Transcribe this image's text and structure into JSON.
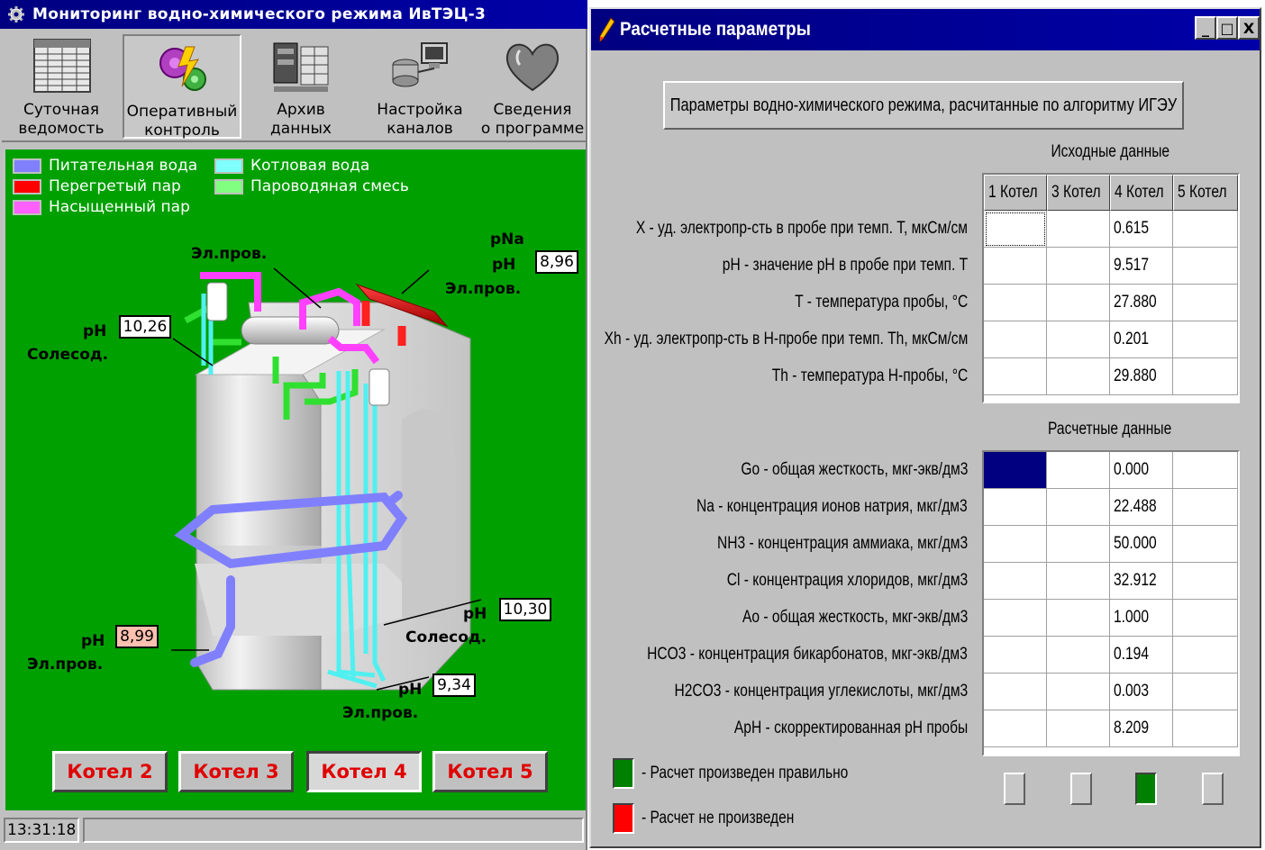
{
  "left_window": {
    "title": "Мониторинг водно-химического режима ИвТЭЦ-3",
    "toolbar": [
      {
        "label": "Суточная\nведомость",
        "icon": "table-icon"
      },
      {
        "label": "Оперативный\nконтроль",
        "icon": "gears-icon",
        "pressed": true
      },
      {
        "label": "Архив\nданных",
        "icon": "archive-icon"
      },
      {
        "label": "Настройка\nканалов",
        "icon": "network-icon"
      },
      {
        "label": "Сведения\nо программе",
        "icon": "heart-icon"
      }
    ],
    "legend": [
      {
        "label": "Питательная вода",
        "color": "#8080ff"
      },
      {
        "label": "Котловая вода",
        "color": "#80ffff"
      },
      {
        "label": "Перегретый пар",
        "color": "#ff0000"
      },
      {
        "label": "Пароводяная смесь",
        "color": "#80ff80"
      },
      {
        "label": "Насыщенный пар",
        "color": "#ff60ff"
      }
    ],
    "measurements": {
      "pna_label": "pNa",
      "ph_top_label": "pH",
      "ph_top_value": "8,96",
      "el_prov_top_right": "Эл.пров.",
      "el_prov_top_left": "Эл.пров.",
      "ph_left_label": "pH",
      "ph_left_value": "10,26",
      "salt_left": "Солесод.",
      "ph_right_label": "pH",
      "ph_right_value": "10,30",
      "salt_right": "Солесод.",
      "ph_feed_label": "pH",
      "ph_feed_value": "8,99",
      "el_prov_feed": "Эл.пров.",
      "ph_bottom_label": "pH",
      "ph_bottom_value": "9,34",
      "el_prov_bottom": "Эл.пров."
    },
    "boilers": [
      {
        "label": "Котел 2"
      },
      {
        "label": "Котел 3"
      },
      {
        "label": "Котел 4",
        "active": true
      },
      {
        "label": "Котел 5"
      }
    ],
    "status_time": "13:31:18"
  },
  "right_window": {
    "title": "Расчетные параметры",
    "controls": {
      "minimize": "_",
      "maximize": "□",
      "close": "X"
    },
    "header_button": "Параметры водно-химического режима, расчитанные по алгоритму ИГЭУ",
    "input_section_title": "Исходные данные",
    "columns": [
      "1 Котел",
      "3 Котел",
      "4 Котел",
      "5 Котел"
    ],
    "input_rows": [
      {
        "label": "X - уд. электропр-сть в пробе при темп. T, мкСм/см",
        "values": [
          "",
          "",
          "0.615",
          ""
        ]
      },
      {
        "label": "pH - значение pH в пробе при темп. T",
        "values": [
          "",
          "",
          "9.517",
          ""
        ]
      },
      {
        "label": "T - температура пробы, °C",
        "values": [
          "",
          "",
          "27.880",
          ""
        ]
      },
      {
        "label": "Xh - уд. электропр-сть в H-пробе при темп. Th, мкСм/см",
        "values": [
          "",
          "",
          "0.201",
          ""
        ]
      },
      {
        "label": "Th - температура H-пробы, °C",
        "values": [
          "",
          "",
          "29.880",
          ""
        ]
      }
    ],
    "calc_section_title": "Расчетные данные",
    "calc_rows": [
      {
        "label": "Go - общая жесткость, мкг-экв/дм3",
        "values": [
          "",
          "",
          "0.000",
          ""
        ]
      },
      {
        "label": "Na - концентрация ионов натрия, мкг/дм3",
        "values": [
          "",
          "",
          "22.488",
          ""
        ]
      },
      {
        "label": "NH3 - концентрация аммиака, мкг/дм3",
        "values": [
          "",
          "",
          "50.000",
          ""
        ]
      },
      {
        "label": "Cl - концентрация хлоридов, мкг/дм3",
        "values": [
          "",
          "",
          "32.912",
          ""
        ]
      },
      {
        "label": "Ao - общая жесткость, мкг-экв/дм3",
        "values": [
          "",
          "",
          "1.000",
          ""
        ]
      },
      {
        "label": "HCO3 - концентрация бикарбонатов, мкг-экв/дм3",
        "values": [
          "",
          "",
          "0.194",
          ""
        ]
      },
      {
        "label": "H2CO3 - концентрация углекислоты, мкг/дм3",
        "values": [
          "",
          "",
          "0.003",
          ""
        ]
      },
      {
        "label": "ApH - скорректированная pH пробы",
        "values": [
          "",
          "",
          "8.209",
          ""
        ]
      }
    ],
    "status_legend": [
      {
        "label": "- Расчет произведен правильно",
        "color": "#008000"
      },
      {
        "label": "- Расчет не произведен",
        "color": "#ff0000"
      }
    ],
    "indicators": [
      false,
      false,
      true,
      false
    ]
  }
}
